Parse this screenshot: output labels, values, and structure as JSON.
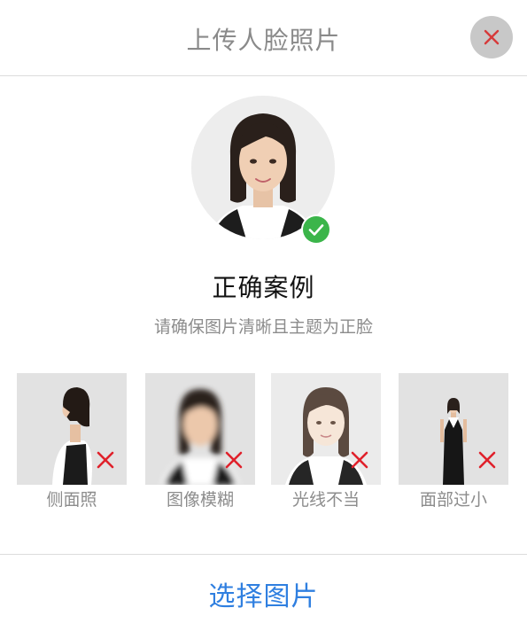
{
  "header": {
    "title": "上传人脸照片",
    "close_icon": "close-icon"
  },
  "correct": {
    "title": "正确案例",
    "subtitle": "请确保图片清晰且主题为正脸",
    "badge_icon": "check-icon",
    "badge_color": "#3bb54a"
  },
  "examples": [
    {
      "label": "侧面照"
    },
    {
      "label": "图像模糊"
    },
    {
      "label": "光线不当"
    },
    {
      "label": "面部过小"
    }
  ],
  "error_color": "#e0212b",
  "footer": {
    "select_label": "选择图片",
    "accent_color": "#2f7fe0"
  }
}
